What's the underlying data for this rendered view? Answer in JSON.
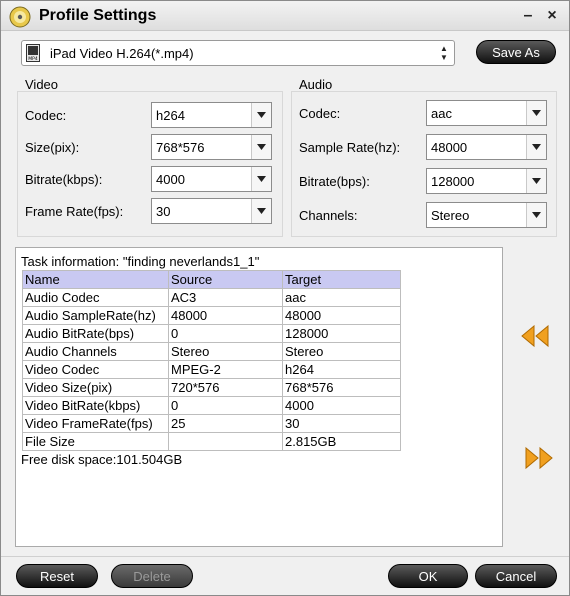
{
  "window": {
    "title": "Profile Settings",
    "minimize_label": "–",
    "close_label": "×"
  },
  "profile": {
    "selected": "iPad Video H.264(*.mp4)",
    "save_as_label": "Save As",
    "format_badge": "MP4"
  },
  "video": {
    "label": "Video",
    "codec_label": "Codec:",
    "codec_value": "h264",
    "size_label": "Size(pix):",
    "size_value": "768*576",
    "bitrate_label": "Bitrate(kbps):",
    "bitrate_value": "4000",
    "framerate_label": "Frame Rate(fps):",
    "framerate_value": "30"
  },
  "audio": {
    "label": "Audio",
    "codec_label": "Codec:",
    "codec_value": "aac",
    "samplerate_label": "Sample Rate(hz):",
    "samplerate_value": "48000",
    "bitrate_label": "Bitrate(bps):",
    "bitrate_value": "128000",
    "channels_label": "Channels:",
    "channels_value": "Stereo"
  },
  "task": {
    "title": "Task information: \"finding neverlands1_1\"",
    "headers": [
      "Name",
      "Source",
      "Target"
    ],
    "rows": [
      [
        "Audio Codec",
        "AC3",
        "aac"
      ],
      [
        "Audio SampleRate(hz)",
        "48000",
        "48000"
      ],
      [
        "Audio BitRate(bps)",
        "0",
        "128000"
      ],
      [
        "Audio Channels",
        "Stereo",
        "Stereo"
      ],
      [
        "Video Codec",
        "MPEG-2",
        "h264"
      ],
      [
        "Video Size(pix)",
        "720*576",
        "768*576"
      ],
      [
        "Video BitRate(kbps)",
        "0",
        "4000"
      ],
      [
        "Video FrameRate(fps)",
        "25",
        "30"
      ],
      [
        "File Size",
        "",
        "2.815GB"
      ]
    ],
    "disk_space": "Free disk space:101.504GB"
  },
  "buttons": {
    "reset": "Reset",
    "delete": "Delete",
    "ok": "OK",
    "cancel": "Cancel"
  },
  "colors": {
    "accent_arrow": "#f0a020",
    "table_header": "#c9c9f2"
  }
}
